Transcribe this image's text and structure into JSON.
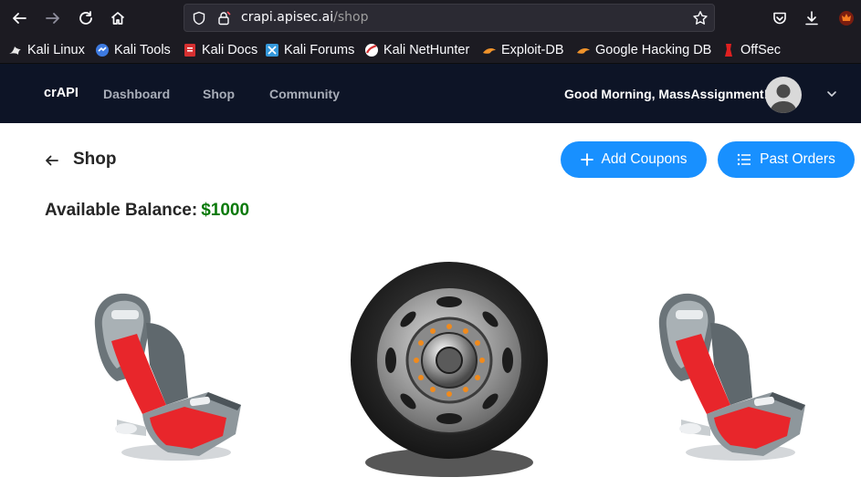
{
  "browser": {
    "url_protocol_hidden": "",
    "url_host": "crapi.apisec.ai",
    "url_path": "/shop",
    "bookmarks": [
      {
        "label": "Kali Linux",
        "icon": "kali-dragon-icon"
      },
      {
        "label": "Kali Tools",
        "icon": "kali-tools-icon"
      },
      {
        "label": "Kali Docs",
        "icon": "kali-docs-icon"
      },
      {
        "label": "Kali Forums",
        "icon": "kali-forums-icon"
      },
      {
        "label": "Kali NetHunter",
        "icon": "kali-nethunter-icon"
      },
      {
        "label": "Exploit-DB",
        "icon": "exploit-db-icon"
      },
      {
        "label": "Google Hacking DB",
        "icon": "ghdb-icon"
      },
      {
        "label": "OffSec",
        "icon": "offsec-icon"
      }
    ]
  },
  "app": {
    "brand": "crAPI",
    "nav": [
      "Dashboard",
      "Shop",
      "Community"
    ],
    "greeting": "Good Morning, MassAssignment!"
  },
  "page": {
    "title": "Shop",
    "add_coupons_label": "Add Coupons",
    "past_orders_label": "Past Orders",
    "balance_label": "Available Balance:",
    "balance_value": "$1000",
    "accent_color": "#1890ff",
    "balance_color": "#0a7a0a"
  },
  "products": [
    {
      "icon": "car-seat-icon"
    },
    {
      "icon": "wheel-icon"
    },
    {
      "icon": "car-seat-icon"
    }
  ]
}
